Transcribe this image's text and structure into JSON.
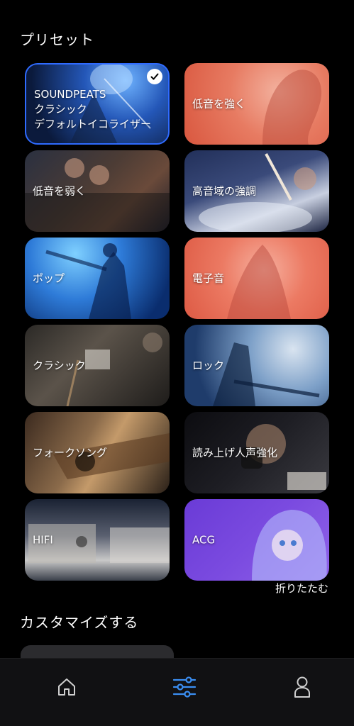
{
  "presets": {
    "title": "プリセット",
    "cards": [
      {
        "label": "SOUNDPEATS\nクラシック\nデフォルトイコライザー",
        "selected": true
      },
      {
        "label": "低音を強く",
        "selected": false
      },
      {
        "label": "低音を弱く",
        "selected": false
      },
      {
        "label": "高音域の強調",
        "selected": false
      },
      {
        "label": "ポップ",
        "selected": false
      },
      {
        "label": "電子音",
        "selected": false
      },
      {
        "label": "クラシック",
        "selected": false
      },
      {
        "label": "ロック",
        "selected": false
      },
      {
        "label": "フォークソング",
        "selected": false
      },
      {
        "label": "読み上げ人声強化",
        "selected": false
      },
      {
        "label": "HIFI",
        "selected": false
      },
      {
        "label": "ACG",
        "selected": false
      }
    ],
    "collapse_label": "折りたたむ"
  },
  "custom": {
    "title": "カスタマイズする"
  },
  "tabbar": {
    "items": [
      {
        "name": "home",
        "icon": "home-icon",
        "active": false
      },
      {
        "name": "equalizer",
        "icon": "equalizer-icon",
        "active": true
      },
      {
        "name": "profile",
        "icon": "person-icon",
        "active": false
      }
    ]
  },
  "colors": {
    "accent": "#3b8ff3",
    "selected_border": "#2f6bff",
    "background": "#000000",
    "tab_inactive": "#d0d0d0"
  }
}
